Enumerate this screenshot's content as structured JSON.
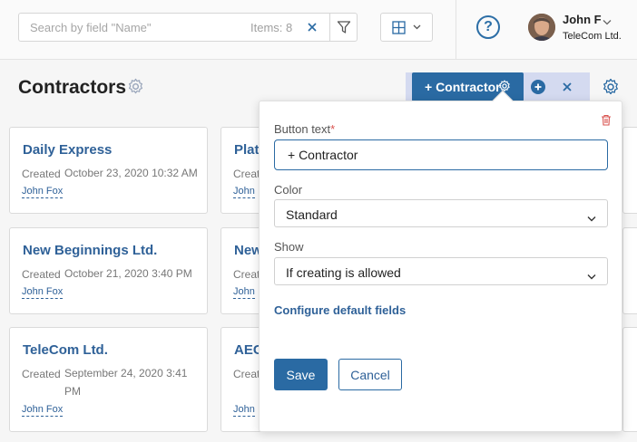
{
  "header": {
    "search_placeholder": "Search by field \"Name\"",
    "items_count": "Items: 8",
    "user_name": "John F",
    "user_company": "TeleCom Ltd."
  },
  "page": {
    "title": "Contractors"
  },
  "cards": [
    {
      "name": "Daily Express",
      "created_label": "Created",
      "created_value": "October 23, 2020 10:32 AM",
      "author": "John Fox"
    },
    {
      "name": "Plat",
      "created_label": "Creat",
      "author": "John"
    },
    {
      "name": "New Beginnings Ltd.",
      "created_label": "Created",
      "created_value": "October 21, 2020 3:40 PM",
      "author": "John Fox"
    },
    {
      "name": "New",
      "created_label": "Creat",
      "author": "John"
    },
    {
      "name": "TeleCom Ltd.",
      "created_label": "Created",
      "created_value": "September 24, 2020 3:41 PM",
      "author": "John Fox"
    },
    {
      "name": "AEC",
      "created_label": "Creat",
      "author": "John"
    }
  ],
  "action_bar": {
    "contractor_button_label": "+ Contractor"
  },
  "popover": {
    "button_text_label": "Button text",
    "required_mark": "*",
    "button_text_value": "+ Contractor",
    "color_label": "Color",
    "color_value": "Standard",
    "show_label": "Show",
    "show_value": "If creating is allowed",
    "configure_link": "Configure default fields",
    "save_label": "Save",
    "cancel_label": "Cancel"
  },
  "colors": {
    "accent": "#2a6aa3",
    "link": "#2f6198",
    "required": "#d9534f",
    "action_bar_bg": "#d4daf0"
  },
  "icons": [
    "close-icon",
    "filter-icon",
    "grid-view-icon",
    "chevron-down-icon",
    "help-icon",
    "gear-icon",
    "add-circle-icon",
    "trash-icon"
  ]
}
